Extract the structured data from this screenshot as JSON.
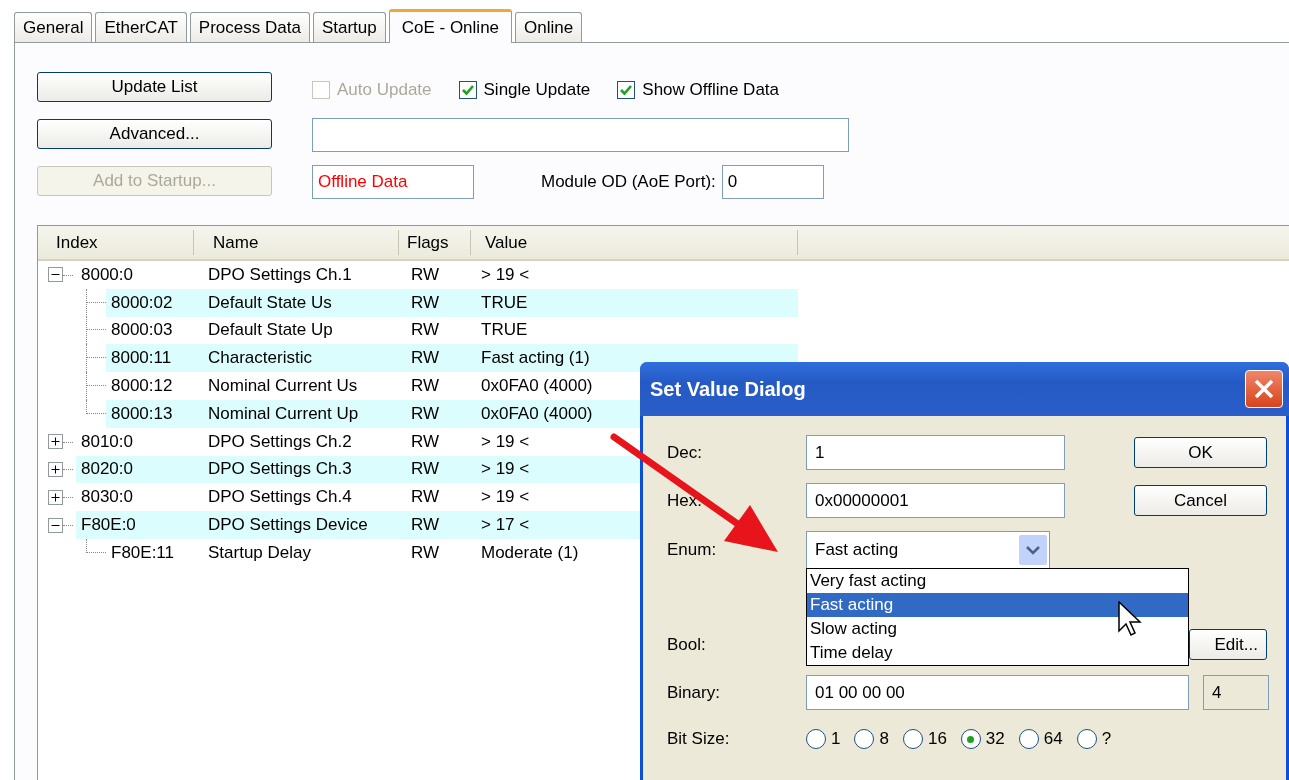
{
  "tabs": [
    {
      "label": "General",
      "selected": false
    },
    {
      "label": "EtherCAT",
      "selected": false
    },
    {
      "label": "Process Data",
      "selected": false
    },
    {
      "label": "Startup",
      "selected": false
    },
    {
      "label": "CoE - Online",
      "selected": true
    },
    {
      "label": "Online",
      "selected": false
    }
  ],
  "buttons": [
    {
      "label": "Update List",
      "disabled": false
    },
    {
      "label": "Advanced...",
      "disabled": false
    },
    {
      "label": "Add to Startup...",
      "disabled": true
    }
  ],
  "options": [
    {
      "label": "Auto Update",
      "checked": false,
      "disabled": true
    },
    {
      "label": "Single Update",
      "checked": true,
      "disabled": false
    },
    {
      "label": "Show Offline Data",
      "checked": true,
      "disabled": false
    }
  ],
  "data_source_field": {
    "value": "Offline Data"
  },
  "module_od": {
    "label": "Module OD (AoE Port):",
    "value": "0"
  },
  "object_list": {
    "columns": [
      "Index",
      "Name",
      "Flags",
      "Value"
    ],
    "rows": [
      {
        "index": "8000:0",
        "name": "DPO Settings Ch.1",
        "flags": "RW",
        "value": "> 19 <",
        "expanded": true,
        "children": [
          {
            "index": "8000:02",
            "name": "Default State Us",
            "flags": "RW",
            "value": "TRUE"
          },
          {
            "index": "8000:03",
            "name": "Default State Up",
            "flags": "RW",
            "value": "TRUE"
          },
          {
            "index": "8000:11",
            "name": "Characteristic",
            "flags": "RW",
            "value": "Fast acting (1)"
          },
          {
            "index": "8000:12",
            "name": "Nominal Current Us",
            "flags": "RW",
            "value": "0x0FA0 (4000)"
          },
          {
            "index": "8000:13",
            "name": "Nominal Current Up",
            "flags": "RW",
            "value": "0x0FA0 (4000)"
          }
        ]
      },
      {
        "index": "8010:0",
        "name": "DPO Settings Ch.2",
        "flags": "RW",
        "value": "> 19 <",
        "expanded": false
      },
      {
        "index": "8020:0",
        "name": "DPO Settings Ch.3",
        "flags": "RW",
        "value": "> 19 <",
        "expanded": false
      },
      {
        "index": "8030:0",
        "name": "DPO Settings Ch.4",
        "flags": "RW",
        "value": "> 19 <",
        "expanded": false
      },
      {
        "index": "F80E:0",
        "name": "DPO Settings Device",
        "flags": "RW",
        "value": "> 17 <",
        "expanded": true,
        "children": [
          {
            "index": "F80E:11",
            "name": "Startup Delay",
            "flags": "RW",
            "value": "Moderate (1)"
          }
        ]
      }
    ]
  },
  "dialog": {
    "title": "Set Value Dialog",
    "fields": [
      {
        "kind": "text",
        "label": "Dec:",
        "value": "1"
      },
      {
        "kind": "text",
        "label": "Hex:",
        "value": "0x00000001"
      },
      {
        "kind": "combo",
        "label": "Enum:",
        "value": "Fast acting"
      },
      {
        "kind": "bool",
        "label": "Bool:",
        "button": "Edit..."
      },
      {
        "kind": "binary",
        "label": "Binary:",
        "value": "01 00 00 00",
        "size": "4"
      },
      {
        "kind": "radio",
        "label": "Bit Size:"
      }
    ],
    "buttons": [
      {
        "label": "OK"
      },
      {
        "label": "Cancel"
      }
    ],
    "enum_options": [
      {
        "label": "Very fast acting",
        "selected": false
      },
      {
        "label": "Fast acting",
        "selected": true
      },
      {
        "label": "Slow acting",
        "selected": false
      },
      {
        "label": "Time delay",
        "selected": false
      }
    ],
    "bit_sizes": [
      {
        "label": "1",
        "selected": false
      },
      {
        "label": "8",
        "selected": false
      },
      {
        "label": "16",
        "selected": false
      },
      {
        "label": "32",
        "selected": true
      },
      {
        "label": "64",
        "selected": false
      },
      {
        "label": "?",
        "selected": false
      }
    ]
  }
}
